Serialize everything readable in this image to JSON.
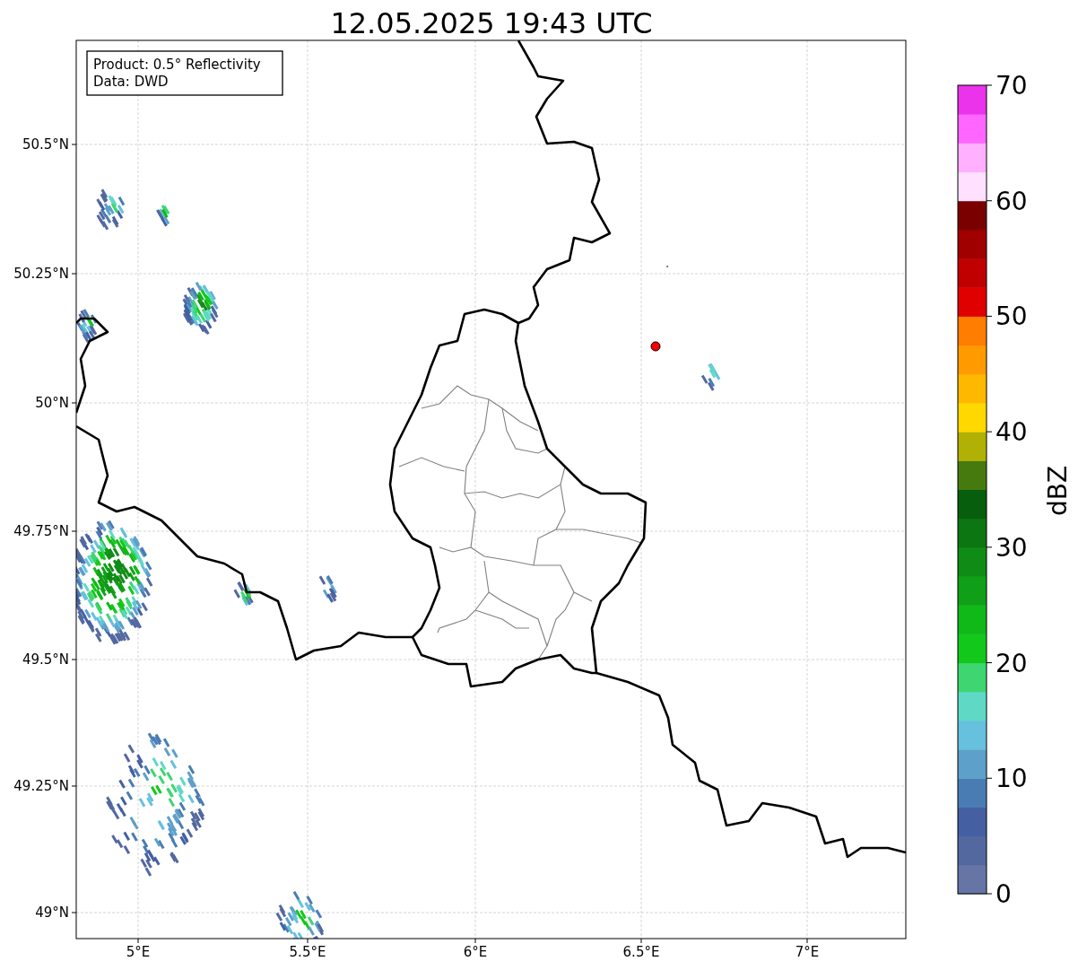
{
  "title": "12.05.2025 19:43 UTC",
  "info_box": {
    "lines": [
      "Product: 0.5° Reflectivity",
      "Data: DWD"
    ]
  },
  "map": {
    "lat_ticks": [
      "50.5°N",
      "50.25°N",
      "50°N",
      "49.75°N",
      "49.5°N",
      "49.25°N",
      "49°N"
    ],
    "lon_ticks": [
      "5°E",
      "5.5°E",
      "6°E",
      "6.5°E",
      "7°E"
    ]
  },
  "colorbar": {
    "label": "dBZ",
    "ticks": [
      "70",
      "60",
      "50",
      "40",
      "30",
      "20",
      "10",
      "0"
    ],
    "bins": [
      {
        "color": "#6675a6"
      },
      {
        "color": "#5468a0"
      },
      {
        "color": "#4460a3"
      },
      {
        "color": "#4a7cb4"
      },
      {
        "color": "#5da0c9"
      },
      {
        "color": "#66c0de"
      },
      {
        "color": "#5fd9c6"
      },
      {
        "color": "#3dd671"
      },
      {
        "color": "#12c81a"
      },
      {
        "color": "#10b818"
      },
      {
        "color": "#10a017"
      },
      {
        "color": "#0e8c15"
      },
      {
        "color": "#0b7612"
      },
      {
        "color": "#075e0c"
      },
      {
        "color": "#467a0e"
      },
      {
        "color": "#b0b005"
      },
      {
        "color": "#ffd800"
      },
      {
        "color": "#ffb800"
      },
      {
        "color": "#ff9a00"
      },
      {
        "color": "#ff7d00"
      },
      {
        "color": "#e00000"
      },
      {
        "color": "#c00000"
      },
      {
        "color": "#a00000"
      },
      {
        "color": "#7a0000"
      },
      {
        "color": "#ffe0ff"
      },
      {
        "color": "#ffb0ff"
      },
      {
        "color": "#ff66ff"
      },
      {
        "color": "#ea33ea"
      }
    ]
  }
}
